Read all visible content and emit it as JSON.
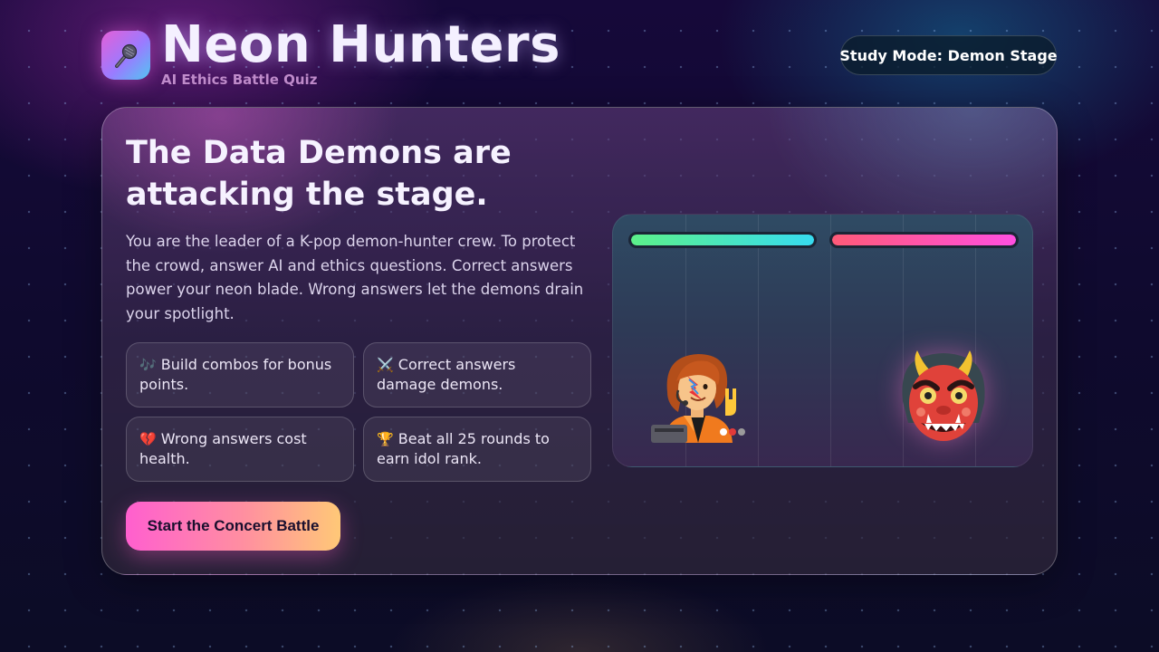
{
  "header": {
    "title": "Neon Hunters",
    "subtitle": "AI Ethics Battle Quiz",
    "mode_badge": "Study Mode: Demon Stage",
    "logo_icon": "microphone-icon"
  },
  "intro": {
    "headline": "The Data Demons are attacking the stage.",
    "description": "You are the leader of a K-pop demon-hunter crew. To protect the crowd, answer AI and ethics questions. Correct answers power your neon blade. Wrong answers let the demons drain your spotlight."
  },
  "tips": [
    {
      "icon": "🎶",
      "icon_name": "music-notes-icon",
      "text": "Build combos for bonus points."
    },
    {
      "icon": "⚔️",
      "icon_name": "crossed-swords-icon",
      "text": "Correct answers damage demons."
    },
    {
      "icon": "💔",
      "icon_name": "broken-heart-icon",
      "text": "Wrong answers cost health."
    },
    {
      "icon": "🏆",
      "icon_name": "trophy-icon",
      "text": "Beat all 25 rounds to earn idol rank."
    }
  ],
  "start_button": {
    "label": "Start the Concert Battle"
  },
  "arena": {
    "player_health": 1.0,
    "demon_health": 1.0,
    "player_icon": "rockstar-singer-icon",
    "demon_icon": "oni-demon-icon",
    "colors": {
      "player_bar": [
        "#5cf08a",
        "#37dbf0"
      ],
      "demon_bar": [
        "#ff5a78",
        "#ff4fe0"
      ]
    }
  }
}
